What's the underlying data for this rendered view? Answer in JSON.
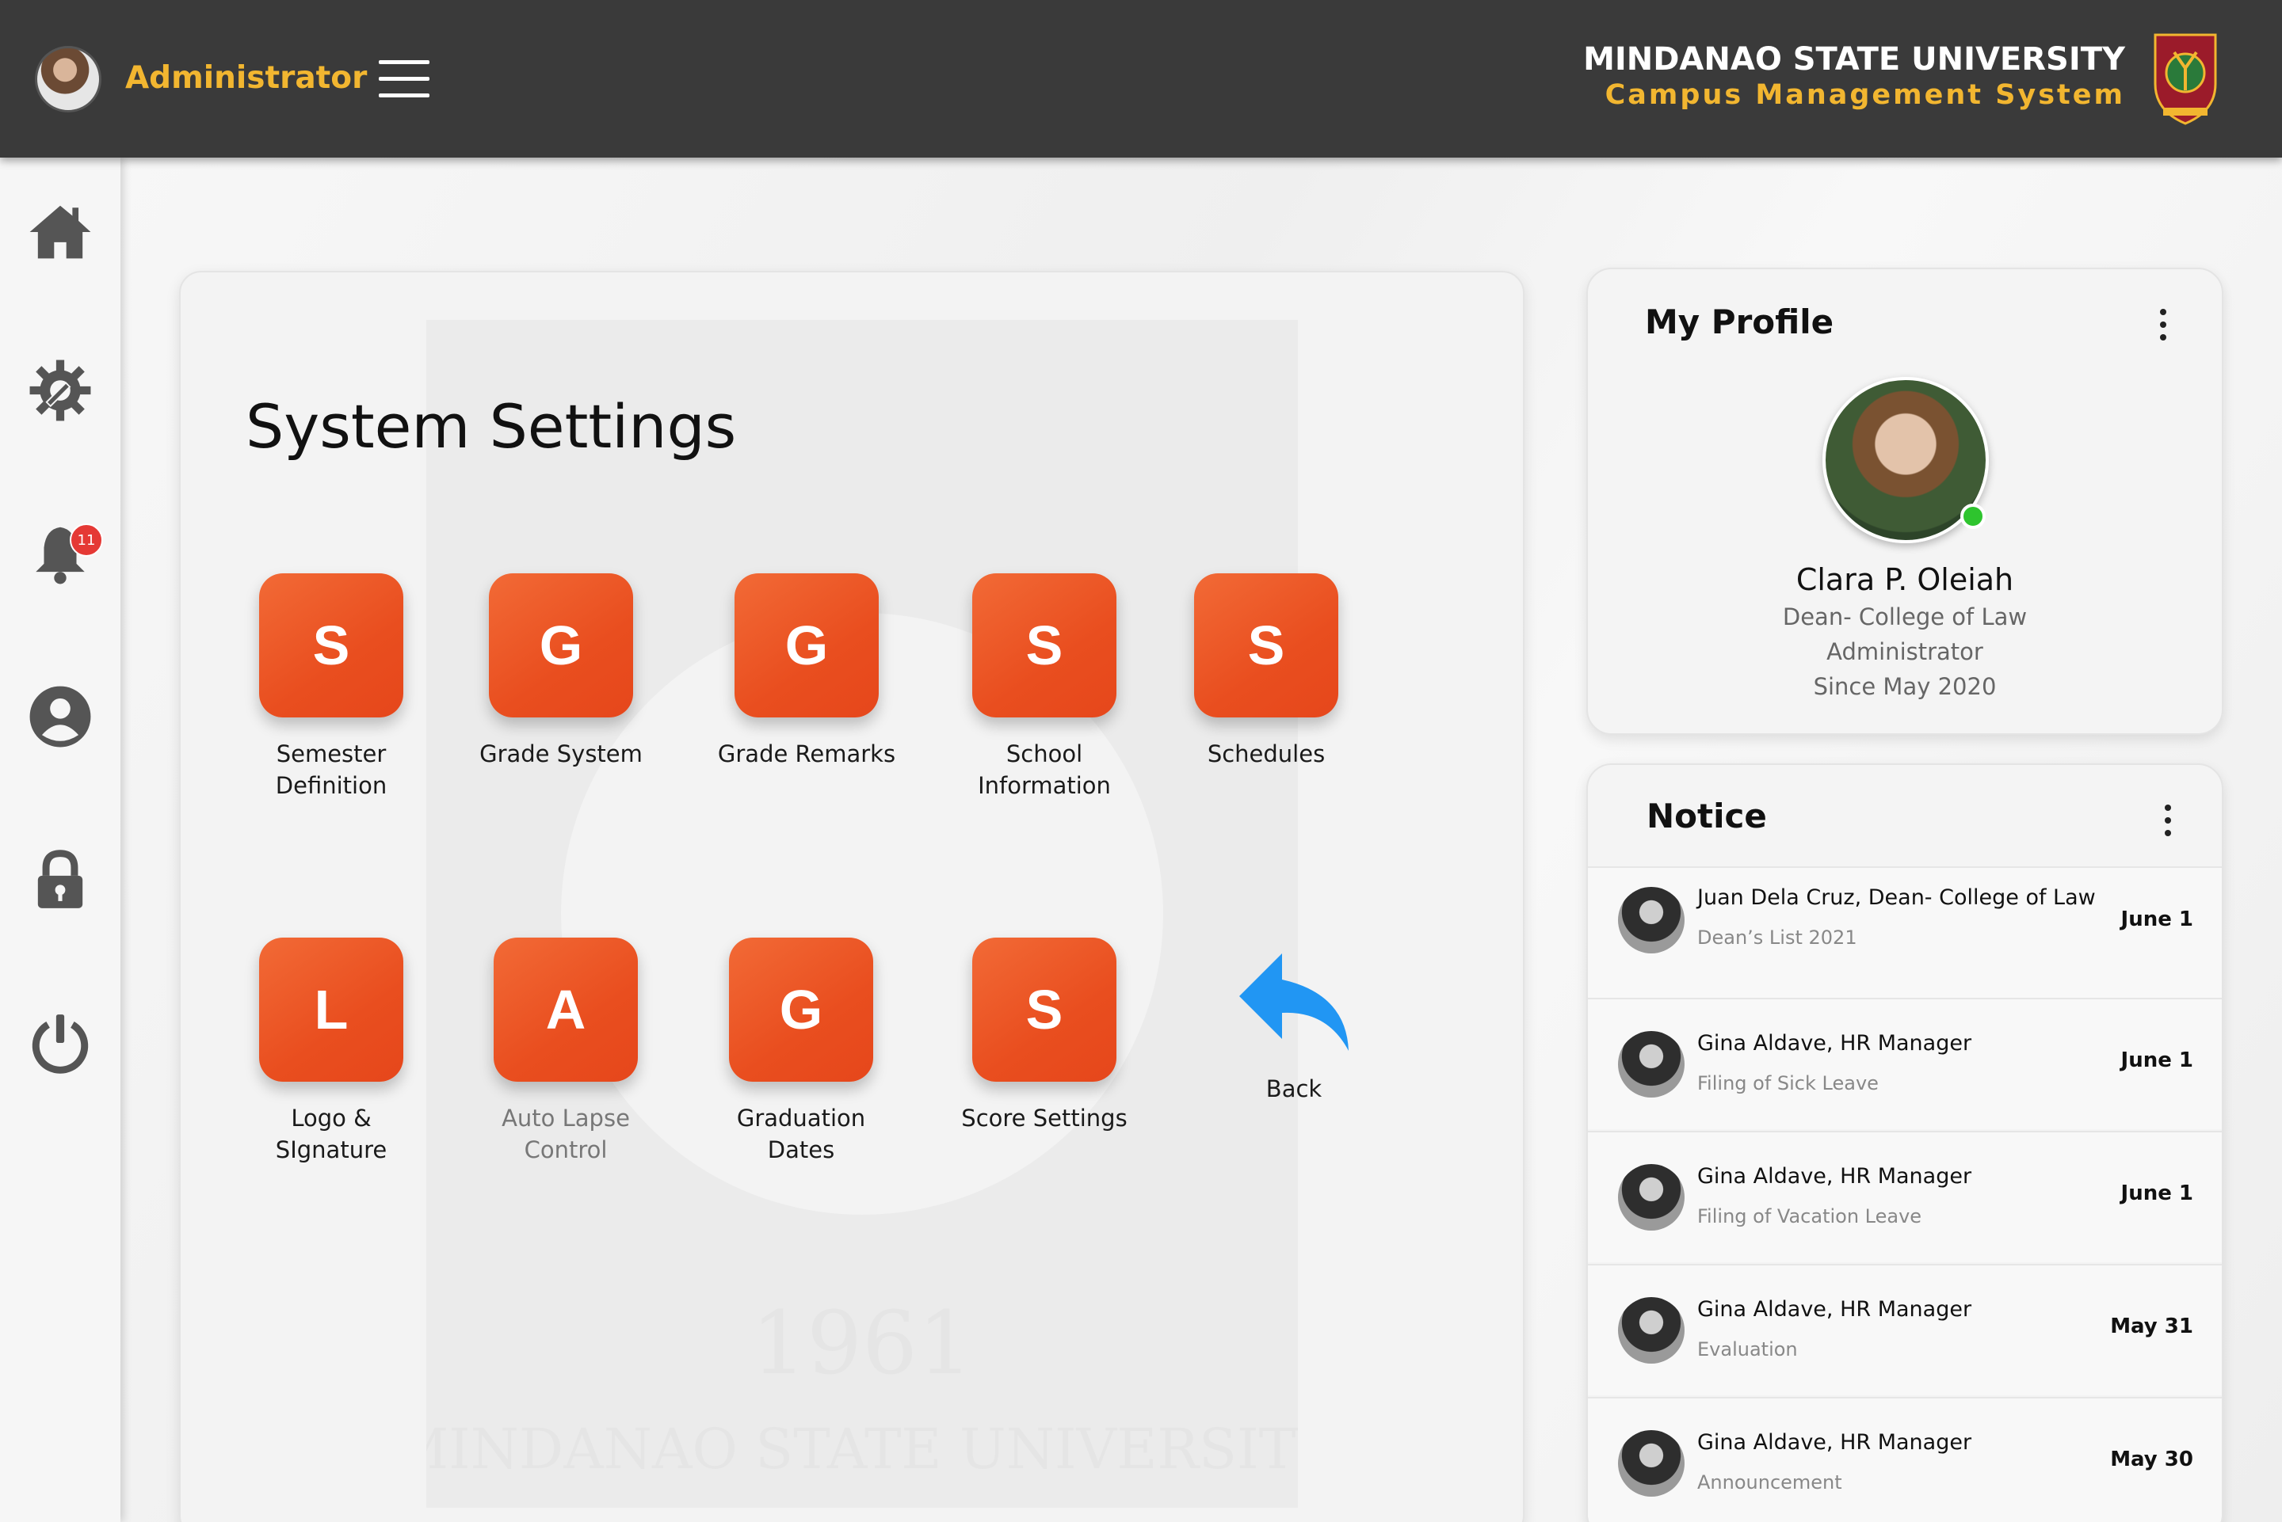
{
  "header": {
    "user_label": "Administrator",
    "university": "MINDANAO STATE UNIVERSITY",
    "system_name": "Campus Management System"
  },
  "sidebar": {
    "items": [
      {
        "name": "home",
        "icon": "home-icon"
      },
      {
        "name": "settings",
        "icon": "gear-wrench-icon"
      },
      {
        "name": "notifications",
        "icon": "bell-icon",
        "badge": "11"
      },
      {
        "name": "profile",
        "icon": "user-icon"
      },
      {
        "name": "security",
        "icon": "lock-icon"
      },
      {
        "name": "logout",
        "icon": "power-icon"
      }
    ]
  },
  "main": {
    "title": "System Settings",
    "tiles": [
      {
        "letter": "S",
        "label_1": "Semester",
        "label_2": "Definition"
      },
      {
        "letter": "G",
        "label_1": "Grade System",
        "label_2": ""
      },
      {
        "letter": "G",
        "label_1": "Grade Remarks",
        "label_2": ""
      },
      {
        "letter": "S",
        "label_1": "School",
        "label_2": "Information"
      },
      {
        "letter": "S",
        "label_1": "Schedules",
        "label_2": ""
      },
      {
        "letter": "L",
        "label_1": "Logo &",
        "label_2": "SIgnature"
      },
      {
        "letter": "A",
        "label_1": "Auto Lapse",
        "label_2": "Control"
      },
      {
        "letter": "G",
        "label_1": "Graduation",
        "label_2": "Dates"
      },
      {
        "letter": "S",
        "label_1": "Score Settings",
        "label_2": ""
      }
    ],
    "back_label": "Back",
    "watermark_year": "1961",
    "watermark_text": "MINDANAO STATE UNIVERSITY"
  },
  "profile": {
    "title": "My Profile",
    "name": "Clara P. Oleiah",
    "position": "Dean- College of Law",
    "role": "Administrator",
    "since": "Since May 2020"
  },
  "notice": {
    "title": "Notice",
    "items": [
      {
        "name": "Juan Dela Cruz, Dean- College of Law",
        "subject": "Dean’s List 2021",
        "date": "June 1"
      },
      {
        "name": "Gina Aldave, HR Manager",
        "subject": "Filing of Sick Leave",
        "date": "June 1"
      },
      {
        "name": "Gina Aldave, HR Manager",
        "subject": "Filing of Vacation Leave",
        "date": "June 1"
      },
      {
        "name": "Gina Aldave, HR Manager",
        "subject": "Evaluation",
        "date": "May 31"
      },
      {
        "name": "Gina Aldave, HR Manager",
        "subject": "Announcement",
        "date": "May 30"
      }
    ]
  },
  "colors": {
    "topbar": "#3a3a3a",
    "accent_gold": "#f2b630",
    "tile_orange": "#ea5222",
    "back_blue": "#2196f3",
    "online_green": "#2ec42e",
    "badge_red": "#e53935"
  }
}
